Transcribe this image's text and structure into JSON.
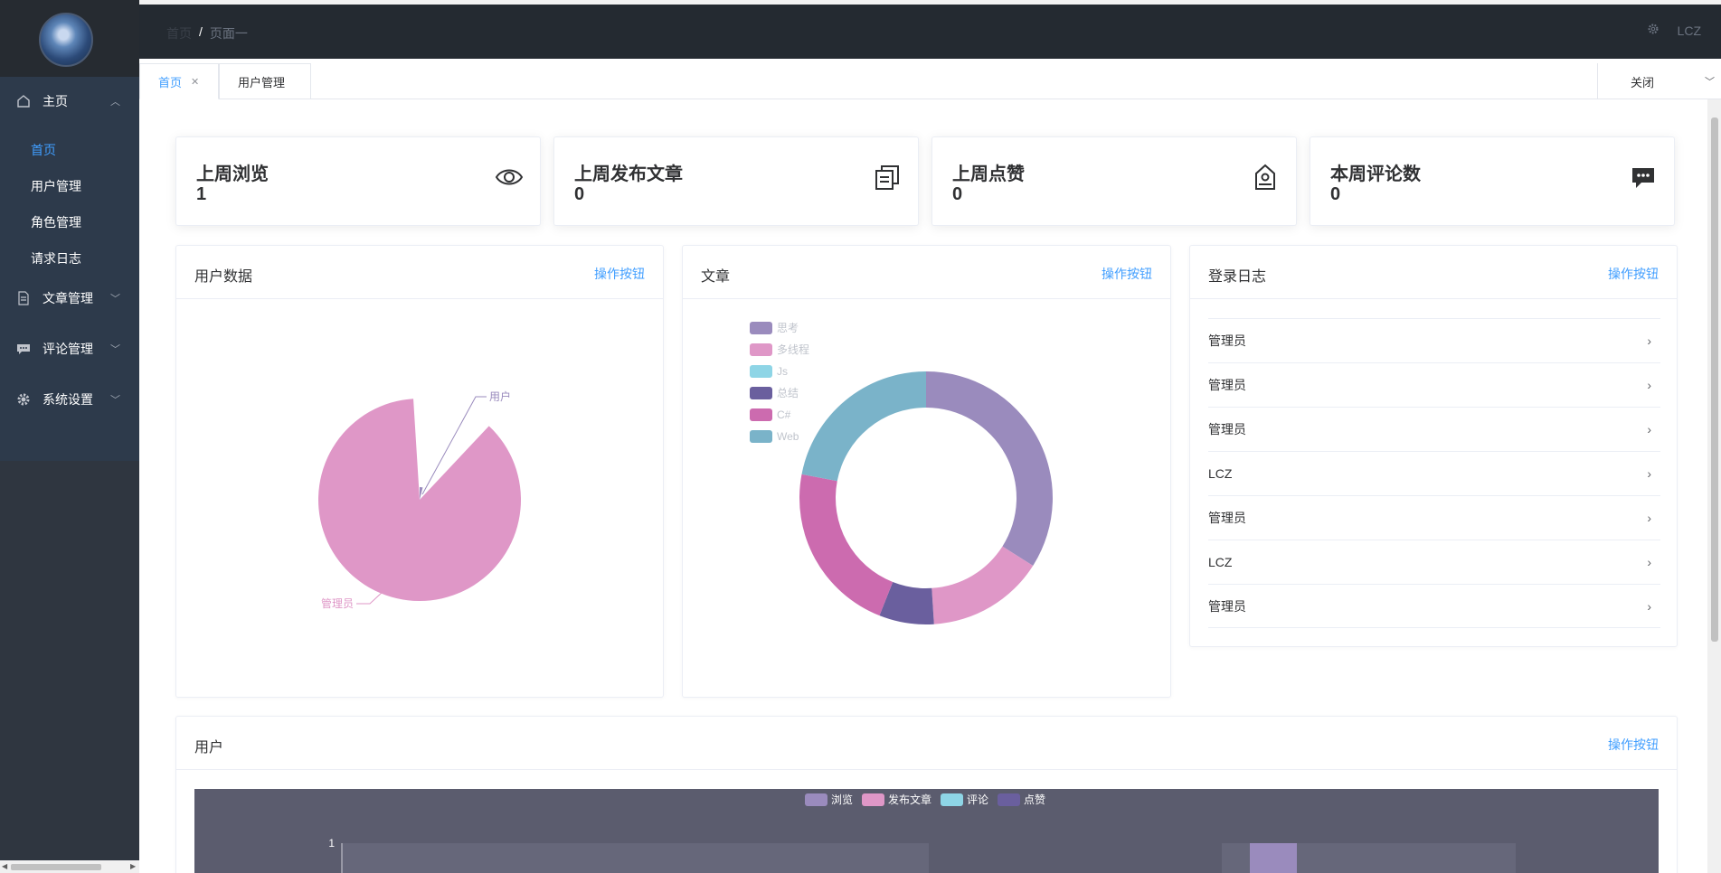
{
  "sidebar": {
    "menu": [
      {
        "label": "主页",
        "icon": "home-icon",
        "expanded": true
      },
      {
        "label": "文章管理",
        "icon": "document-icon",
        "expanded": false
      },
      {
        "label": "评论管理",
        "icon": "comment-icon",
        "expanded": false
      },
      {
        "label": "系统设置",
        "icon": "gear-icon",
        "expanded": false
      }
    ],
    "submenu": [
      {
        "label": "首页",
        "active": true
      },
      {
        "label": "用户管理"
      },
      {
        "label": "角色管理"
      },
      {
        "label": "请求日志"
      }
    ]
  },
  "header": {
    "breadcrumb": [
      "首页",
      "页面一"
    ],
    "breadcrumb_separator": "/",
    "user": "LCZ"
  },
  "tabs": {
    "items": [
      {
        "label": "首页",
        "active": true,
        "closable": true
      },
      {
        "label": "用户管理"
      }
    ],
    "close_label": "关闭"
  },
  "stats": [
    {
      "title": "上周浏览",
      "value": "1",
      "icon": "eye-icon"
    },
    {
      "title": "上周发布文章",
      "value": "0",
      "icon": "copy-icon"
    },
    {
      "title": "上周点赞",
      "value": "0",
      "icon": "tag-icon"
    },
    {
      "title": "本周评论数",
      "value": "0",
      "icon": "chat-icon"
    }
  ],
  "panels": {
    "op_label": "操作按钮",
    "user_data": {
      "title": "用户数据"
    },
    "articles": {
      "title": "文章"
    },
    "login_log": {
      "title": "登录日志"
    },
    "users": {
      "title": "用户"
    }
  },
  "login_log": [
    "管理员",
    "管理员",
    "管理员",
    "LCZ",
    "管理员",
    "LCZ",
    "管理员"
  ],
  "colors": {
    "accent": "#409eff",
    "sidebar": "#2f3640",
    "header": "#242a31",
    "purple": "#9a8bbd",
    "pink": "#df97c7",
    "cyan": "#8ed5e6",
    "dark_purple": "#6a5f9e",
    "magenta": "#cc6baf",
    "teal": "#7ab3c9"
  },
  "chart_data": [
    {
      "type": "pie",
      "title": "",
      "slices": [
        {
          "label": "管理员",
          "value": 88,
          "color": "#df97c7"
        },
        {
          "label": "用户",
          "value": 1,
          "color": "#9a8bbd"
        }
      ]
    },
    {
      "type": "pie",
      "subtype": "donut",
      "title": "",
      "legend": [
        "思考",
        "多线程",
        "Js",
        "总结",
        "C#",
        "Web"
      ],
      "legend_position": "top-left",
      "slices": [
        {
          "label": "思考",
          "value": 34,
          "color": "#9a8bbd"
        },
        {
          "label": "多线程",
          "value": 15,
          "color": "#df97c7"
        },
        {
          "label": "Js",
          "value": 0,
          "color": "#8ed5e6"
        },
        {
          "label": "总结",
          "value": 7,
          "color": "#6a5f9e"
        },
        {
          "label": "C#",
          "value": 22,
          "color": "#cc6baf"
        },
        {
          "label": "Web",
          "value": 22,
          "color": "#7ab3c9"
        }
      ]
    },
    {
      "type": "bar",
      "title": "",
      "legend": [
        "浏览",
        "发布文章",
        "评论",
        "点赞"
      ],
      "legend_position": "top",
      "y_ticks": [
        "1"
      ],
      "ylim": [
        0,
        1
      ]
    }
  ]
}
